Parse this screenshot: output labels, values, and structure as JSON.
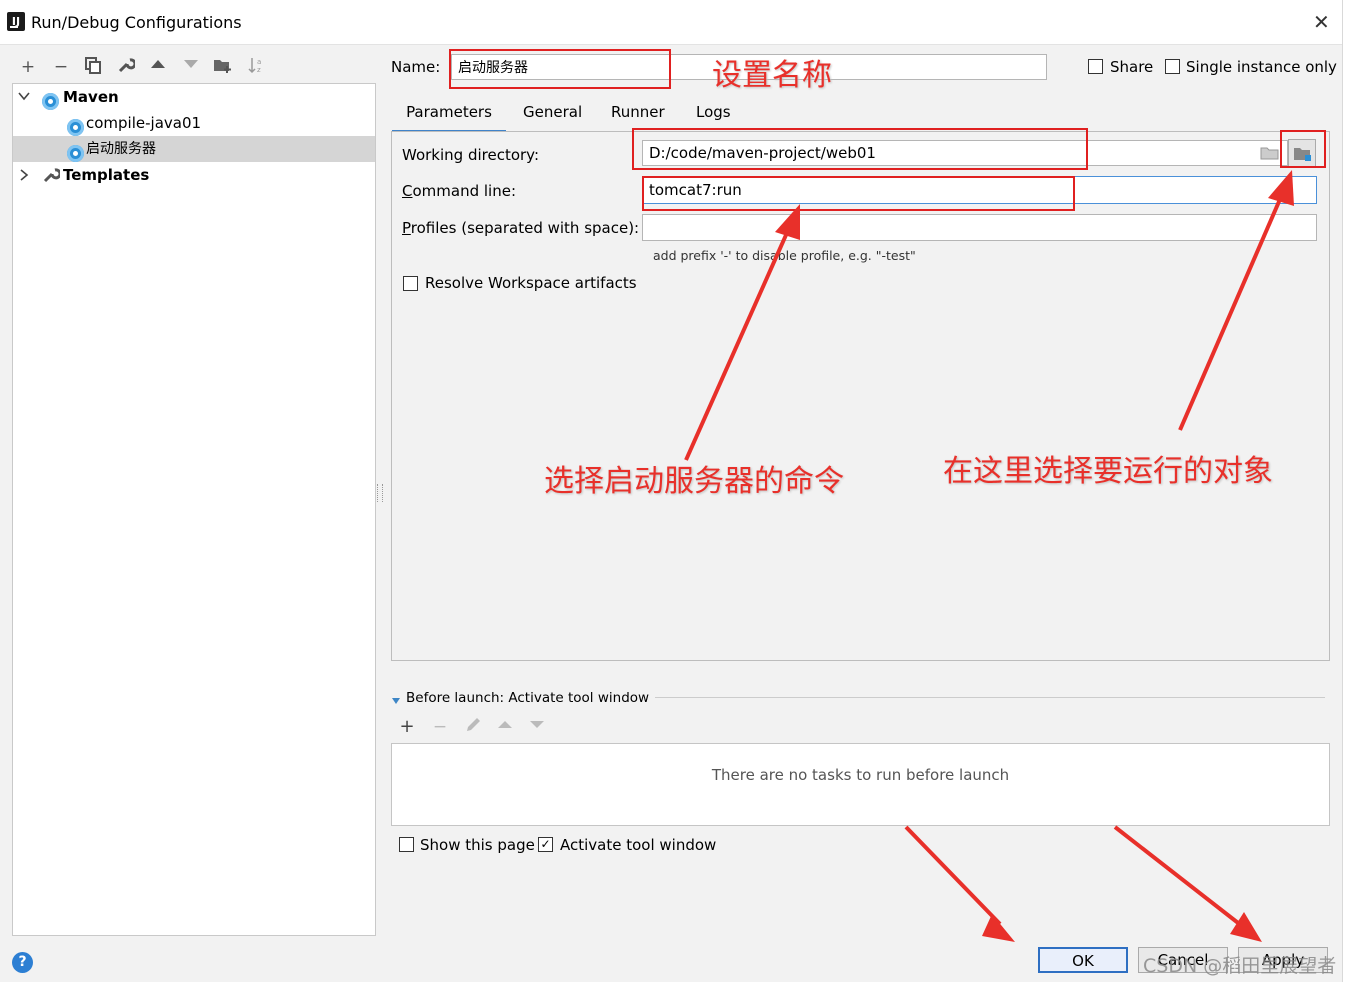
{
  "window": {
    "title": "Run/Debug Configurations"
  },
  "tree": {
    "items": [
      {
        "label": "Maven",
        "expanded": true
      },
      {
        "label": "compile-java01"
      },
      {
        "label": "启动服务器",
        "selected": true
      },
      {
        "label": "Templates",
        "expanded": false
      }
    ]
  },
  "config": {
    "name_label": "Name:",
    "name_value": "启动服务器",
    "share_label": "Share",
    "single_instance_label": "Single instance only"
  },
  "tabs": [
    "Parameters",
    "General",
    "Runner",
    "Logs"
  ],
  "parameters": {
    "working_dir_label": "Working directory:",
    "working_dir_value": "D:/code/maven-project/web01",
    "command_line_label": "Command line:",
    "command_line_value": "tomcat7:run",
    "profiles_label": "Profiles (separated with space):",
    "profiles_value": "",
    "profiles_hint": "add prefix '-' to disable profile, e.g. \"-test\"",
    "resolve_label": "Resolve Workspace artifacts"
  },
  "before_launch": {
    "header": "Before launch: Activate tool window",
    "empty_text": "There are no tasks to run before launch",
    "show_page_label": "Show this page",
    "activate_label": "Activate tool window",
    "activate_checked": true
  },
  "buttons": {
    "ok": "OK",
    "cancel": "Cancel",
    "apply": "Apply"
  },
  "annotations": {
    "set_name": "设置名称",
    "choose_command": "选择启动服务器的命令",
    "choose_target": "在这里选择要运行的对象"
  },
  "watermark": "CSDN @稻田里展望者",
  "colors": {
    "accent": "#4083c9",
    "annotation": "#e8302a",
    "selection": "#d5d5d5"
  },
  "icons": [
    "add-icon",
    "remove-icon",
    "copy-icon",
    "wrench-icon",
    "move-up-icon",
    "move-down-icon",
    "folder-add-icon",
    "sort-icon",
    "help-icon",
    "folder-icon",
    "module-icon",
    "edit-icon"
  ]
}
